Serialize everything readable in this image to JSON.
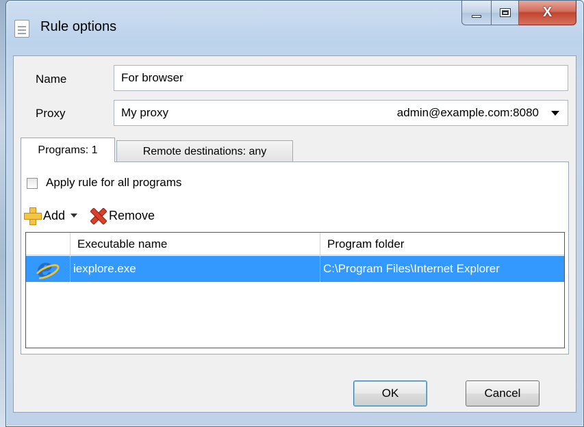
{
  "window": {
    "title": "Rule options",
    "controls": {
      "minimize": "minimize",
      "maximize": "maximize",
      "close": "X"
    }
  },
  "form": {
    "name_label": "Name",
    "name_value": "For browser",
    "proxy_label": "Proxy",
    "proxy_name": "My proxy",
    "proxy_host": "admin@example.com:8080"
  },
  "tabs": [
    {
      "label": "Programs: 1",
      "active": true
    },
    {
      "label": "Remote destinations: any",
      "active": false
    }
  ],
  "programs": {
    "apply_all_label": "Apply rule for all programs",
    "apply_all_checked": false,
    "toolbar": {
      "add_label": "Add",
      "remove_label": "Remove"
    },
    "columns": [
      "",
      "Executable name",
      "Program folder"
    ],
    "rows": [
      {
        "icon": "internet-explorer-icon",
        "executable": "iexplore.exe",
        "folder": "C:\\Program Files\\Internet Explorer",
        "selected": true
      }
    ]
  },
  "buttons": {
    "ok": "OK",
    "cancel": "Cancel"
  },
  "colors": {
    "selection": "#3399ff",
    "title_bar": "#bcd3ec",
    "close_button": "#c24531"
  }
}
